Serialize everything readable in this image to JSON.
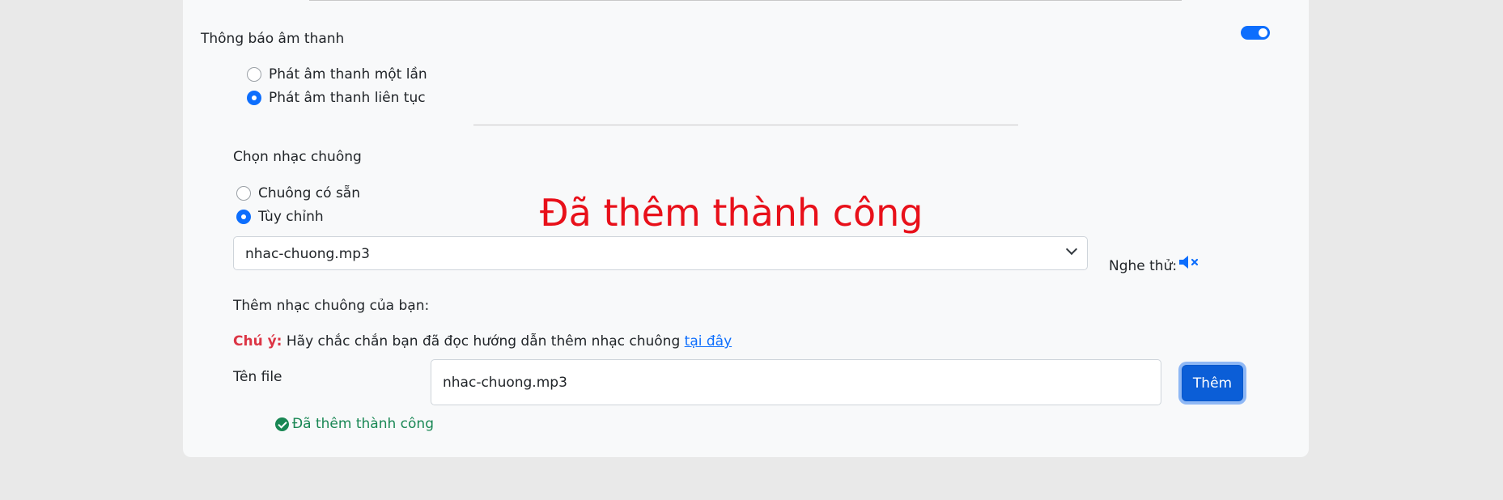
{
  "sound_notification": {
    "title": "Thông báo âm thanh",
    "toggle_on": true,
    "options": [
      {
        "label": "Phát âm thanh một lần",
        "checked": false
      },
      {
        "label": "Phát âm thanh liên tục",
        "checked": true
      }
    ]
  },
  "ringtone": {
    "title": "Chọn nhạc chuông",
    "options": [
      {
        "label": "Chuông có sẵn",
        "checked": false
      },
      {
        "label": "Tùy chỉnh",
        "checked": true
      }
    ],
    "selected": "nhac-chuong.mp3",
    "preview_label": "Nghe thử:"
  },
  "overlay_message": "Đã thêm thành công",
  "add_ringtone": {
    "title": "Thêm nhạc chuông của bạn:",
    "note_label": "Chú ý:",
    "note_text": "Hãy chắc chắn bạn đã đọc hướng dẫn thêm nhạc chuông",
    "note_link": "tại đây",
    "file_label": "Tên file",
    "file_value": "nhac-chuong.mp3",
    "add_button": "Thêm",
    "success_message": "Đã thêm thành công"
  },
  "colors": {
    "accent": "#0d6efd",
    "success": "#198754",
    "warning": "#dc3545",
    "overlay": "#e8101a"
  }
}
